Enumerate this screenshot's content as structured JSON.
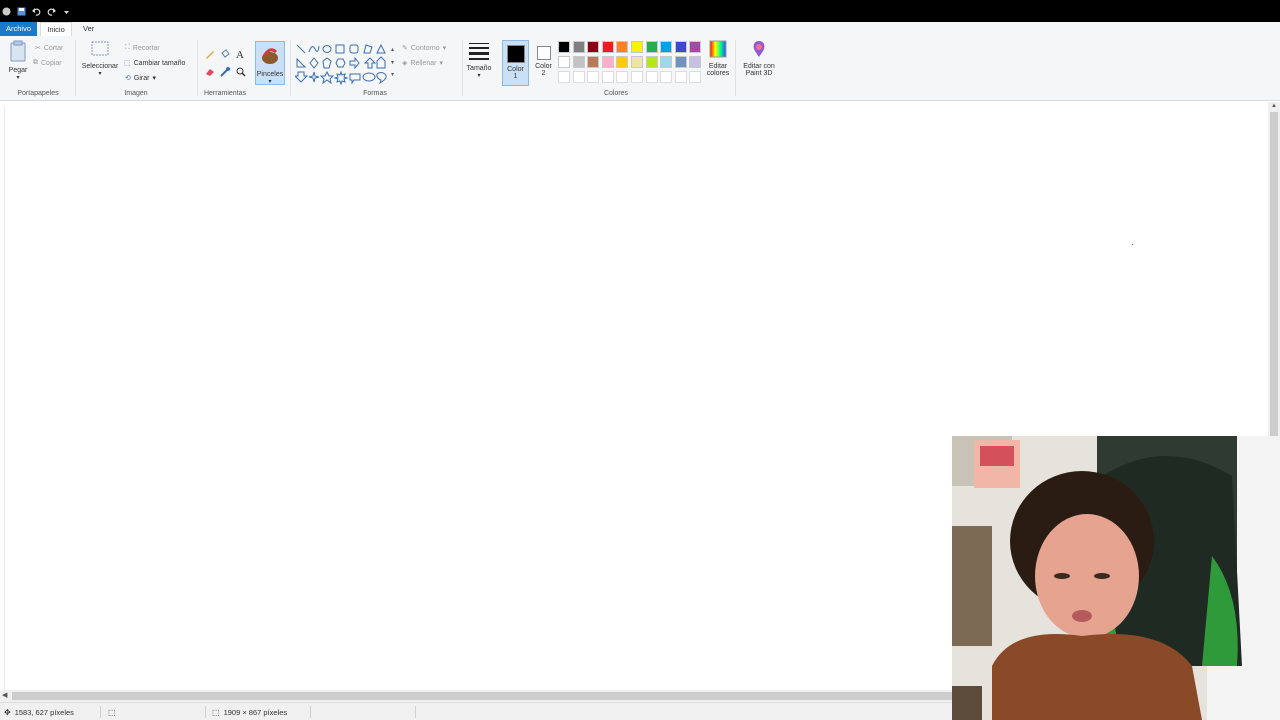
{
  "tabs": {
    "file": "Archivo",
    "home": "Inicio",
    "view": "Ver"
  },
  "clipboard": {
    "paste": "Pegar",
    "cut": "Cortar",
    "copy": "Copiar",
    "label": "Portapapeles"
  },
  "image": {
    "select": "Seleccionar",
    "crop": "Recortar",
    "resize": "Cambiar tamaño",
    "rotate": "Girar",
    "label": "Imagen"
  },
  "tools": {
    "label": "Herramientas",
    "brushes": "Pinceles"
  },
  "shapes": {
    "outline": "Contorno",
    "fill": "Rellenar",
    "label": "Formas"
  },
  "size": {
    "label": "Tamaño"
  },
  "colors": {
    "color1": "Color",
    "color1_num": "1",
    "color2": "Color",
    "color2_num": "2",
    "edit": "Editar",
    "edit2": "colores",
    "paint3d": "Editar con",
    "paint3d2": "Paint 3D",
    "label": "Colores",
    "color1_value": "#000000",
    "color2_value": "#ffffff",
    "palette_row1": [
      "#000000",
      "#7f7f7f",
      "#880015",
      "#ed1c24",
      "#ff7f27",
      "#fff200",
      "#22b14c",
      "#00a2e8",
      "#3f48cc",
      "#a349a4"
    ],
    "palette_row2": [
      "#ffffff",
      "#c3c3c3",
      "#b97a57",
      "#ffaec9",
      "#ffc90e",
      "#efe4b0",
      "#b5e61d",
      "#99d9ea",
      "#7092be",
      "#c8bfe7"
    ],
    "palette_row3": [
      "#ffffff",
      "#ffffff",
      "#ffffff",
      "#ffffff",
      "#ffffff",
      "#ffffff",
      "#ffffff",
      "#ffffff",
      "#ffffff",
      "#ffffff"
    ]
  },
  "status": {
    "cursor_pos": "1583, 627 píxeles",
    "canvas_size": "1909 × 867 píxeles"
  }
}
